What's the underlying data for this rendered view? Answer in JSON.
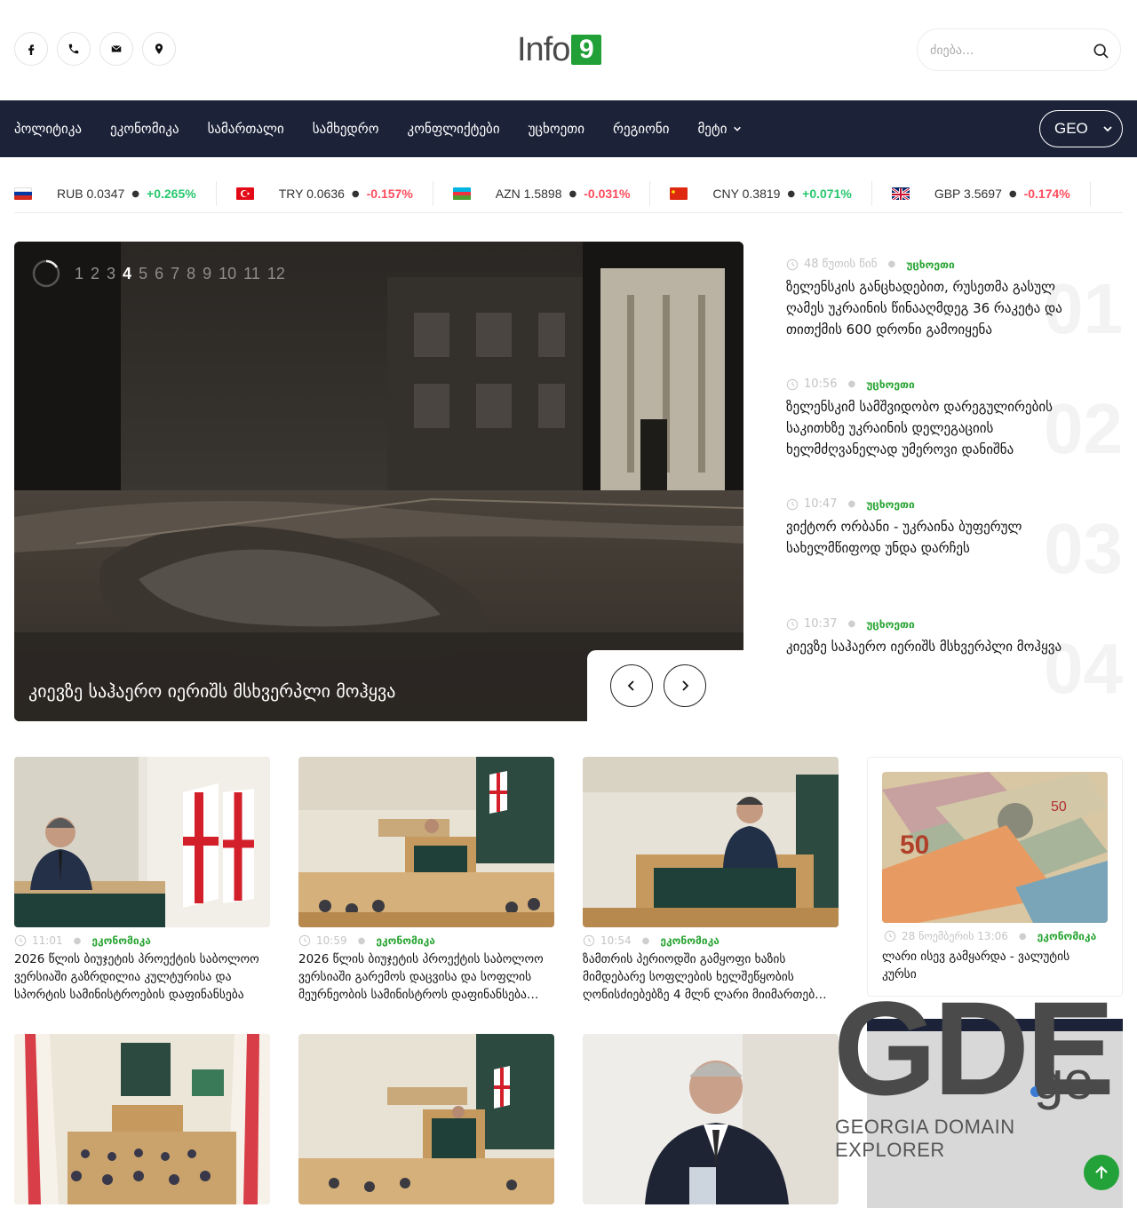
{
  "header": {
    "logo_text": "Info",
    "logo_badge": "9",
    "search_placeholder": "ძიება...",
    "social": [
      "facebook-icon",
      "phone-icon",
      "mail-icon",
      "location-icon"
    ]
  },
  "nav": {
    "items": [
      "პოლიტიკა",
      "ეკონომიკა",
      "სამართალი",
      "სამხედრო",
      "კონფლიქტები",
      "უცხოეთი",
      "რეგიონი",
      "მეტი"
    ],
    "language": "GEO"
  },
  "ticker": [
    {
      "flag": "ru",
      "code": "RUB 0.0347",
      "change": "+0.265%",
      "dir": "pos"
    },
    {
      "flag": "tr",
      "code": "TRY 0.0636",
      "change": "-0.157%",
      "dir": "neg"
    },
    {
      "flag": "az",
      "code": "AZN 1.5898",
      "change": "-0.031%",
      "dir": "neg"
    },
    {
      "flag": "cn",
      "code": "CNY 0.3819",
      "change": "+0.071%",
      "dir": "pos"
    },
    {
      "flag": "gb",
      "code": "GBP 3.5697",
      "change": "-0.174%",
      "dir": "neg"
    }
  ],
  "hero": {
    "pages": [
      "1",
      "2",
      "3",
      "4",
      "5",
      "6",
      "7",
      "8",
      "9",
      "10",
      "11",
      "12"
    ],
    "active_page": "4",
    "title": "კიევზე საჰაერო იერიშს მსხვერპლი მოჰყვა"
  },
  "side_list": [
    {
      "num": "01",
      "time": "48 წუთის წინ",
      "category": "უცხოეთი",
      "title": "ზელენსკის განცხადებით, რუსეთმა გასულ ღამეს უკრაინის წინააღმდეგ 36 რაკეტა და თითქმის 600 დრონი გამოიყენა"
    },
    {
      "num": "02",
      "time": "10:56",
      "category": "უცხოეთი",
      "title": "ზელენსკიმ სამშვიდობო დარეგულირების საკითხზე უკრაინის დელეგაციის ხელმძღვანელად უმეროვი დანიშნა"
    },
    {
      "num": "03",
      "time": "10:47",
      "category": "უცხოეთი",
      "title": "ვიქტორ ორბანი - უკრაინა ბუფერულ სახელმწიფოდ უნდა დარჩეს"
    },
    {
      "num": "04",
      "time": "10:37",
      "category": "უცხოეთი",
      "title": "კიევზე საჰაერო იერიშს მსხვერპლი მოჰყვა"
    }
  ],
  "cards": [
    {
      "time": "11:01",
      "category": "ეკონომიკა",
      "title": "2026 წლის ბიუჯეტის პროექტის საბოლოო ვერსიაში გაზრდილია კულტურისა და სპორტის სამინისტროების დაფინანსება"
    },
    {
      "time": "10:59",
      "category": "ეკონომიკა",
      "title": "2026 წლის ბიუჯეტის პროექტის საბოლოო ვერსიაში გარემოს დაცვისა და სოფლის მეურნეობის სამინისტროს დაფინანსება…"
    },
    {
      "time": "10:54",
      "category": "ეკონომიკა",
      "title": "ზამთრის პერიოდში გამყოფი ხაზის მიმდებარე სოფლების ხელშეწყობის ღონისძიებებზე 4 მლნ ლარი მიიმართებ…"
    },
    {
      "time": "28 ნოემბერის 13:06",
      "category": "ეკონომიკა",
      "title": "ლარი ისევ გამყარდა - ვალუტის კურსი"
    }
  ],
  "ad": {
    "brand_main": "GDE",
    "brand_suffix": "ge",
    "tagline": "GEORGIA DOMAIN EXPLORER"
  },
  "colors": {
    "nav_bg": "#1c2339",
    "accent_green": "#2aa534",
    "positive": "#28c76f",
    "negative": "#ff4d5e"
  }
}
